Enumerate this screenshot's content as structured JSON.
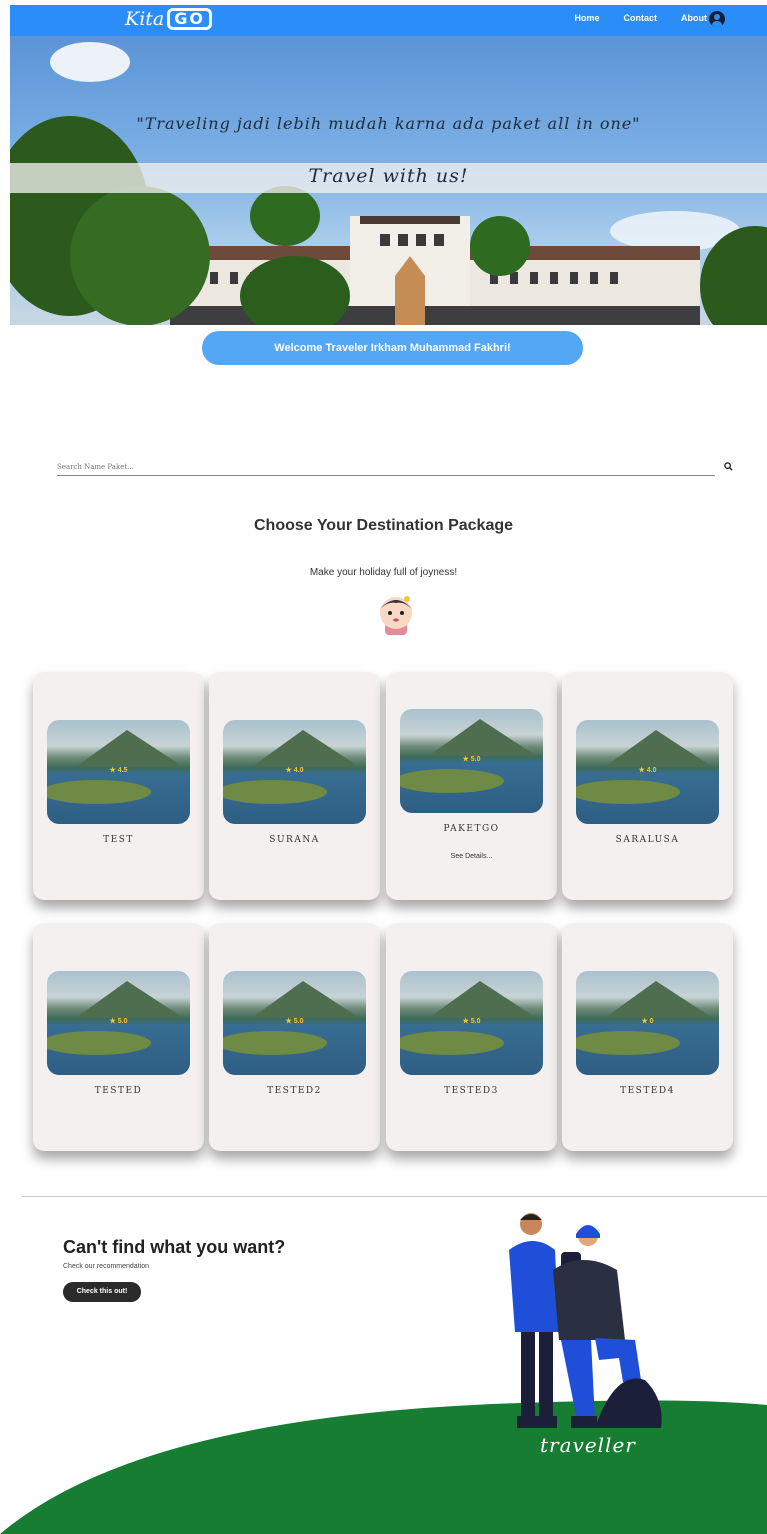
{
  "nav": {
    "logo_text": "Kita",
    "logo_go": "GO",
    "links": [
      "Home",
      "Contact",
      "About Us"
    ]
  },
  "hero": {
    "quote": "\"Traveling jadi lebih mudah karna ada paket all in one\"",
    "tagline": "Travel with us!"
  },
  "welcome": "Welcome Traveler Irkham Muhammad Fakhri!",
  "search": {
    "placeholder": "Search Name Paket..."
  },
  "section": {
    "title": "Choose Your Destination Package",
    "subtitle": "Make your holiday full of joyness!"
  },
  "packages": [
    {
      "name": "TEST",
      "rating": "★ 4.5"
    },
    {
      "name": "SURANA",
      "rating": "★ 4.0"
    },
    {
      "name": "PAKETGO",
      "rating": "★ 5.0",
      "details": "See Details..."
    },
    {
      "name": "SARALUSA",
      "rating": "★ 4.0"
    },
    {
      "name": "TESTED",
      "rating": "★ 5.0"
    },
    {
      "name": "TESTED2",
      "rating": "★ 5.0"
    },
    {
      "name": "TESTED3",
      "rating": "★ 5.0"
    },
    {
      "name": "TESTED4",
      "rating": "★ 0"
    }
  ],
  "cta": {
    "title": "Can't find what you want?",
    "subtitle": "Check our recommendation",
    "button": "Check this out!"
  },
  "illustration_caption": "traveller",
  "colors": {
    "primary": "#2b8df7",
    "welcome": "#54a7f5",
    "ground": "#167d33",
    "card": "#f5f0f0"
  }
}
